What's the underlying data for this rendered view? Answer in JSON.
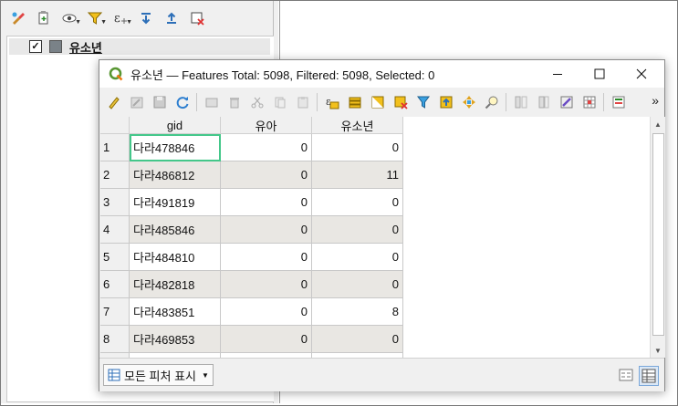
{
  "layer_panel": {
    "layer_name": "유소년",
    "checked": true,
    "swatch_color": "#7a8288",
    "toolbar_icons": [
      "style-manager-icon",
      "add-group-icon",
      "visibility-eye-icon",
      "filter-legend-icon",
      "expression-filter-icon",
      "expand-all-icon",
      "collapse-all-icon",
      "remove-layer-icon"
    ]
  },
  "attribute_window": {
    "title": "유소년 — Features Total: 5098, Filtered: 5098, Selected: 0",
    "controls": {
      "minimize": "—",
      "maximize": "☐",
      "close": "✕"
    },
    "toolbar_more": "»",
    "columns": [
      "gid",
      "유아",
      "유소년"
    ],
    "rows": [
      {
        "num": "1",
        "gid": "다라478846",
        "c1": "0",
        "c2": "0"
      },
      {
        "num": "2",
        "gid": "다라486812",
        "c1": "0",
        "c2": "11"
      },
      {
        "num": "3",
        "gid": "다라491819",
        "c1": "0",
        "c2": "0"
      },
      {
        "num": "4",
        "gid": "다라485846",
        "c1": "0",
        "c2": "0"
      },
      {
        "num": "5",
        "gid": "다라484810",
        "c1": "0",
        "c2": "0"
      },
      {
        "num": "6",
        "gid": "다라482818",
        "c1": "0",
        "c2": "0"
      },
      {
        "num": "7",
        "gid": "다라483851",
        "c1": "0",
        "c2": "8"
      },
      {
        "num": "8",
        "gid": "다라469853",
        "c1": "0",
        "c2": "0"
      }
    ],
    "show_all_label": "모든 피처 표시",
    "accent_focus_color": "#44c78a",
    "alt_row_color": "#e9e7e3"
  }
}
